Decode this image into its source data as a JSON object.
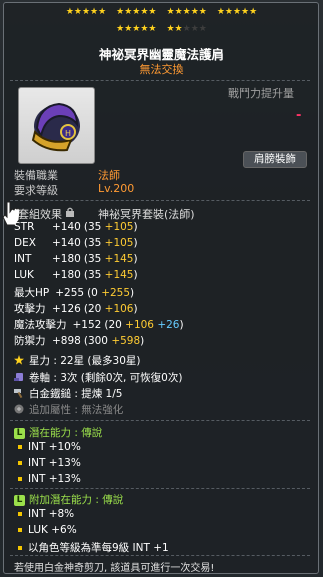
{
  "stars": {
    "row1": [
      "★★★★★",
      "★★★★★",
      "★★★★★",
      "★★★★★"
    ],
    "row2_filled": [
      "★★★★★",
      "★★"
    ],
    "row2_empty": [
      "★★★"
    ]
  },
  "item": {
    "name": "神祕冥界幽靈魔法護肩",
    "trade": "無法交換",
    "power_label": "戰鬥力提升量",
    "power_mark": "-",
    "slot_button": "肩膀裝飾",
    "job_label": "裝備職業",
    "job_value": "法師",
    "level_label": "要求等級",
    "level_value": "Lv.200"
  },
  "set": {
    "label": "套組效果",
    "name": "神祕冥界套裝(法師)"
  },
  "stats": [
    {
      "name": "STR",
      "total": "+140",
      "base": "(35 ",
      "bonus": "+105",
      "end": ")"
    },
    {
      "name": "DEX",
      "total": "+140",
      "base": "(35 ",
      "bonus": "+105",
      "end": ")"
    },
    {
      "name": "INT",
      "total": "+180",
      "base": "(35 ",
      "bonus": "+145",
      "end": ")"
    },
    {
      "name": "LUK",
      "total": "+180",
      "base": "(35 ",
      "bonus": "+145",
      "end": ")"
    },
    {
      "name": "最大HP",
      "total": "+255",
      "base": "(0 ",
      "bonus": "+255",
      "end": ")"
    },
    {
      "name": "攻擊力",
      "total": "+126",
      "base": "(20 ",
      "bonus": "+106",
      "end": ")"
    },
    {
      "name": "魔法攻擊力",
      "total": "+152",
      "base": "(20 ",
      "bonus": "+106",
      "end": " ",
      "extra": "+26",
      ")": ")"
    },
    {
      "name": "防禦力",
      "total": "+898",
      "base": "(300 ",
      "bonus": "+598",
      "end": ")"
    }
  ],
  "info": {
    "starforce": "星力 : 22星 (最多30星)",
    "scroll": "卷軸 : 3次 (剩餘0次, 可恢復0次)",
    "hammer": "白金鐵鎚 : 提煉 1/5",
    "extra": "追加屬性 : 無法強化"
  },
  "potential": {
    "tag": "L",
    "label": "潛在能力 : ",
    "grade": "傳說",
    "lines": [
      "INT +10%",
      "INT +13%",
      "INT +13%"
    ]
  },
  "add_potential": {
    "tag": "L",
    "label": "附加潛在能力 : ",
    "grade": "傳說",
    "lines": [
      "INT +8%",
      "LUK +6%",
      "以角色等級為準每9級 INT +1"
    ]
  },
  "footer": "若使用白金神奇剪刀, 該道具可進行一次交易!",
  "colors": {
    "star": "#ffd21e",
    "trade": "#ff9a33",
    "bonus": "#ffcc33",
    "extra": "#66ccff",
    "legend": "#9be04b"
  }
}
